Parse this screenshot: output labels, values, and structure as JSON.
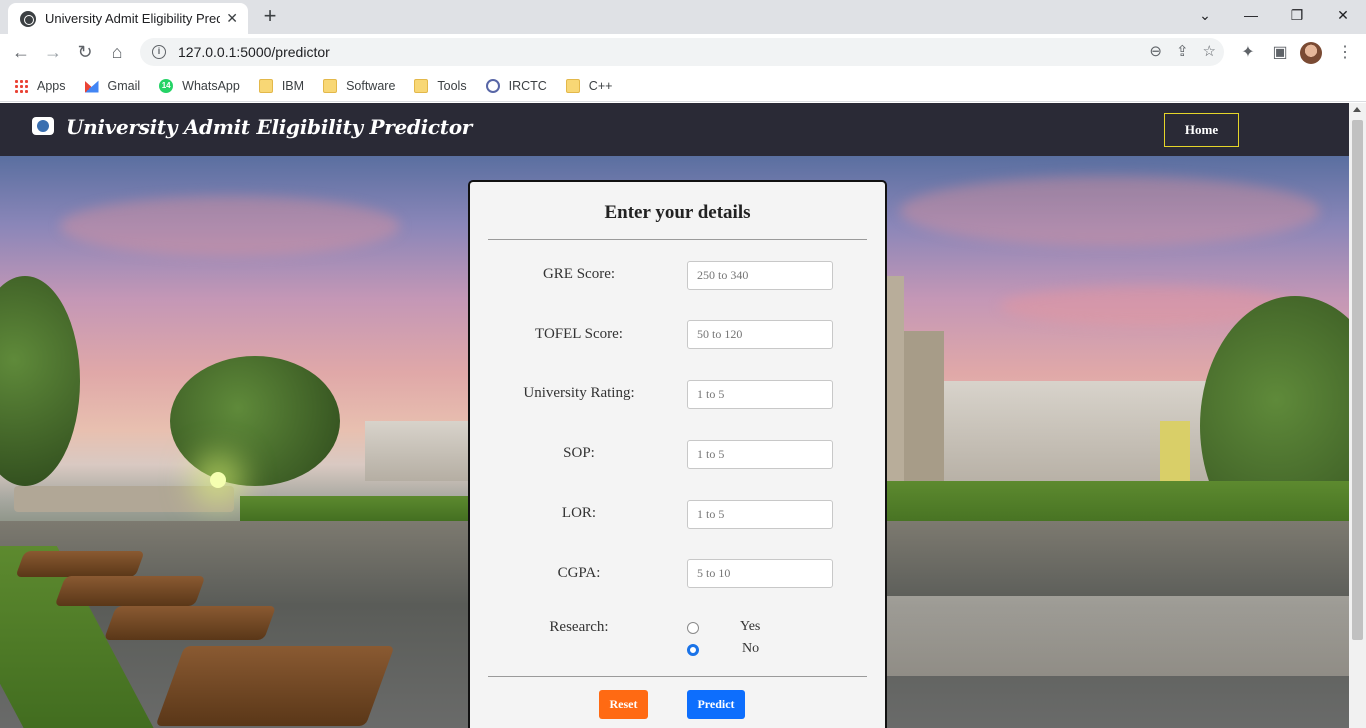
{
  "browser": {
    "tab_title": "University Admit Eligibility Predic",
    "tab_close": "✕",
    "new_tab": "+",
    "url": "127.0.0.1:5000/predictor",
    "bookmarks": [
      {
        "label": "Apps",
        "icon": "apps-grid-icon"
      },
      {
        "label": "Gmail",
        "icon": "gmail-icon"
      },
      {
        "label": "WhatsApp",
        "icon": "whatsapp-icon",
        "badge": "14"
      },
      {
        "label": "IBM",
        "icon": "folder-icon"
      },
      {
        "label": "Software",
        "icon": "folder-icon"
      },
      {
        "label": "Tools",
        "icon": "folder-icon"
      },
      {
        "label": "IRCTC",
        "icon": "irctc-icon"
      },
      {
        "label": "C++",
        "icon": "folder-icon"
      }
    ]
  },
  "navbar": {
    "brand": "University Admit Eligibility Predictor",
    "home": "Home",
    "home_border_color": "#e5d52a"
  },
  "form": {
    "title": "Enter your details",
    "fields": [
      {
        "label": "GRE Score:",
        "placeholder": "250 to 340",
        "value": ""
      },
      {
        "label": "TOFEL Score:",
        "placeholder": "50 to 120",
        "value": ""
      },
      {
        "label": "University Rating:",
        "placeholder": "1 to 5",
        "value": ""
      },
      {
        "label": "SOP:",
        "placeholder": "1 to 5",
        "value": ""
      },
      {
        "label": "LOR:",
        "placeholder": "1 to 5",
        "value": ""
      },
      {
        "label": "CGPA:",
        "placeholder": "5 to 10",
        "value": ""
      }
    ],
    "research": {
      "label": "Research:",
      "options": [
        {
          "label": "Yes",
          "checked": false
        },
        {
          "label": "No",
          "checked": true
        }
      ]
    },
    "reset": "Reset",
    "predict": "Predict",
    "reset_color": "#ff6a13",
    "predict_color": "#0d6efd"
  }
}
